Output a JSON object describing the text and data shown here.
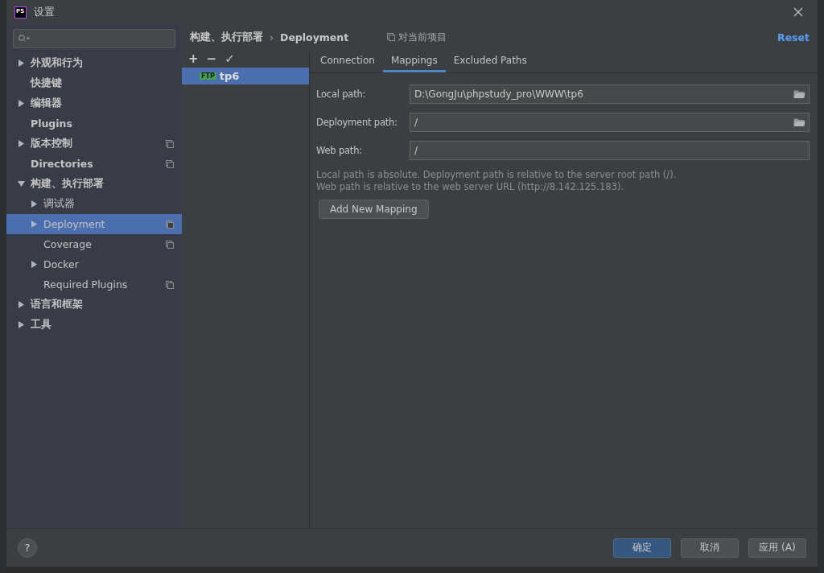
{
  "window": {
    "title": "设置",
    "app_badge": "PS"
  },
  "sidebar": {
    "tree": [
      {
        "label": "外观和行为",
        "expanded": false,
        "selected": false,
        "project_scoped": false
      },
      {
        "label": "快捷键",
        "selected": false,
        "project_scoped": false
      },
      {
        "label": "编辑器",
        "expanded": false,
        "selected": false,
        "project_scoped": false
      },
      {
        "label": "Plugins",
        "selected": false,
        "project_scoped": false
      },
      {
        "label": "版本控制",
        "expanded": false,
        "selected": false,
        "project_scoped": true
      },
      {
        "label": "Directories",
        "selected": false,
        "project_scoped": true
      },
      {
        "label": "构建、执行部署",
        "expanded": true,
        "selected": false,
        "project_scoped": false,
        "children": [
          {
            "label": "调试器",
            "expanded": false,
            "selected": false,
            "project_scoped": false
          },
          {
            "label": "Deployment",
            "expanded": false,
            "selected": true,
            "project_scoped": true
          },
          {
            "label": "Coverage",
            "selected": false,
            "project_scoped": true
          },
          {
            "label": "Docker",
            "expanded": false,
            "selected": false,
            "project_scoped": false
          },
          {
            "label": "Required Plugins",
            "selected": false,
            "project_scoped": true
          }
        ]
      },
      {
        "label": "语言和框架",
        "expanded": false,
        "selected": false,
        "project_scoped": false
      },
      {
        "label": "工具",
        "expanded": false,
        "selected": false,
        "project_scoped": false
      }
    ]
  },
  "header": {
    "breadcrumb": [
      "构建、执行部署",
      "Deployment"
    ],
    "separator": "›",
    "scope_note": "对当前项目",
    "reset": "Reset"
  },
  "servers": {
    "toolbar": [
      "+",
      "−",
      "✓"
    ],
    "items": [
      {
        "name": "tp6",
        "badge": "FTP",
        "selected": true
      }
    ]
  },
  "tabs": [
    {
      "label": "Connection",
      "selected": false
    },
    {
      "label": "Mappings",
      "selected": true
    },
    {
      "label": "Excluded Paths",
      "selected": false
    }
  ],
  "fields": [
    {
      "label": "Local path:",
      "value": "D:\\GongJu\\phpstudy_pro\\WWW\\tp6",
      "browse": true
    },
    {
      "label": "Deployment path:",
      "value": "/",
      "browse": true
    },
    {
      "label": "Web path:",
      "value": "/",
      "browse": false
    }
  ],
  "hints": [
    "Local path is absolute. Deployment path is relative to the server root path (/).",
    "Web path is relative to the web server URL (http://8.142.125.183)."
  ],
  "add_mapping": "Add New Mapping",
  "footer": {
    "help": "?",
    "buttons": [
      {
        "label": "确定",
        "primary": true
      },
      {
        "label": "取消",
        "primary": false
      },
      {
        "label": "应用 (A)",
        "primary": false
      }
    ]
  }
}
